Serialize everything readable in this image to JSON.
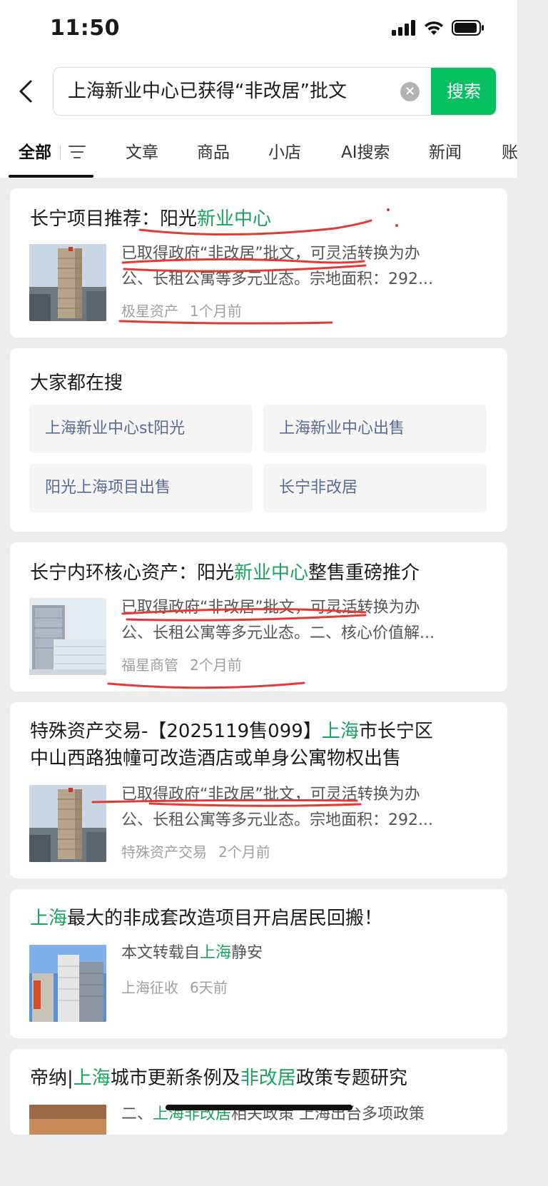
{
  "status_bar": {
    "time": "11:50"
  },
  "search": {
    "query": "上海新业中心已获得“非改居”批文",
    "button_label": "搜索"
  },
  "tabs": [
    {
      "label": "全部",
      "active": true
    },
    {
      "label": "文章"
    },
    {
      "label": "商品"
    },
    {
      "label": "小店"
    },
    {
      "label": "AI搜索"
    },
    {
      "label": "新闻"
    },
    {
      "label": "账"
    }
  ],
  "results": [
    {
      "title_parts": [
        "长宁项目推荐：阳光",
        "新业中心",
        ""
      ],
      "snippet": [
        "已取得政府“非改居”批文，可灵活转换为办",
        "公、长租公寓等多元业态。宗地面积：292..."
      ],
      "source": "极星资产",
      "time": "1个月前"
    },
    {
      "title_parts": [
        "长宁内环核心资产：阳光",
        "新业中心",
        "整售重磅推介"
      ],
      "snippet": [
        "已取得政府“非改居”批文，可灵活转换为办",
        "公、长租公寓等多元业态。二、核心价值解..."
      ],
      "source": "福星商管",
      "time": "2个月前"
    },
    {
      "title_line1": [
        "特殊资产交易-【2025119售099】",
        "上海",
        "市长宁区"
      ],
      "title_line2": "中山西路独幢可改造酒店或单身公寓物权出售",
      "snippet": [
        "已取得政府“非改居”批文，可灵活转换为办",
        "公、长租公寓等多元业态。宗地面积：292..."
      ],
      "source": "特殊资产交易",
      "time": "2个月前"
    },
    {
      "title_parts": [
        "",
        "上海",
        "最大的非成套改造项目开启居民回搬！"
      ],
      "snippet_parts": [
        "本文转载自",
        "上海",
        "静安"
      ],
      "source": "上海征收",
      "time": "6天前"
    },
    {
      "title_parts": [
        "帝纳|",
        "上海",
        "城市更新条例及",
        "非改居",
        "政策专题研究"
      ],
      "snippet_parts": [
        "二、",
        "上海非改居",
        "相关政策 上海出台多项政策"
      ]
    }
  ],
  "hot_searches": {
    "title": "大家都在搜",
    "items": [
      "上海新业中心st阳光",
      "上海新业中心出售",
      "阳光上海项目出售",
      "长宁非改居"
    ]
  },
  "colors": {
    "accent": "#07c160",
    "highlight": "#1aa260",
    "link": "#576b95",
    "annotation": "#e53935"
  }
}
